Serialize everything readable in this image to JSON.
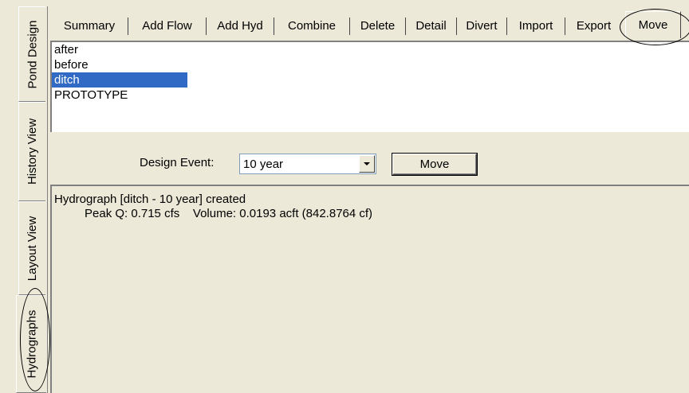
{
  "side_tabs": [
    "Pond Design",
    "History View",
    "Layout View",
    "Hydrographs"
  ],
  "top_tabs": [
    "Summary",
    "Add Flow",
    "Add Hyd",
    "Combine",
    "Delete",
    "Detail",
    "Divert",
    "Import",
    "Export",
    "Move"
  ],
  "list_items": [
    "after",
    "before",
    "ditch",
    "PROTOTYPE"
  ],
  "selected_item": "ditch",
  "design_event": {
    "label": "Design Event:",
    "value": "10 year"
  },
  "move_button": "Move",
  "output": {
    "line1": "Hydrograph [ditch - 10 year] created",
    "line2": "Peak Q: 0.715 cfs    Volume: 0.0193 acft (842.8764 cf)"
  },
  "colors": {
    "selection": "#316ac5",
    "background": "#ece9d8"
  }
}
